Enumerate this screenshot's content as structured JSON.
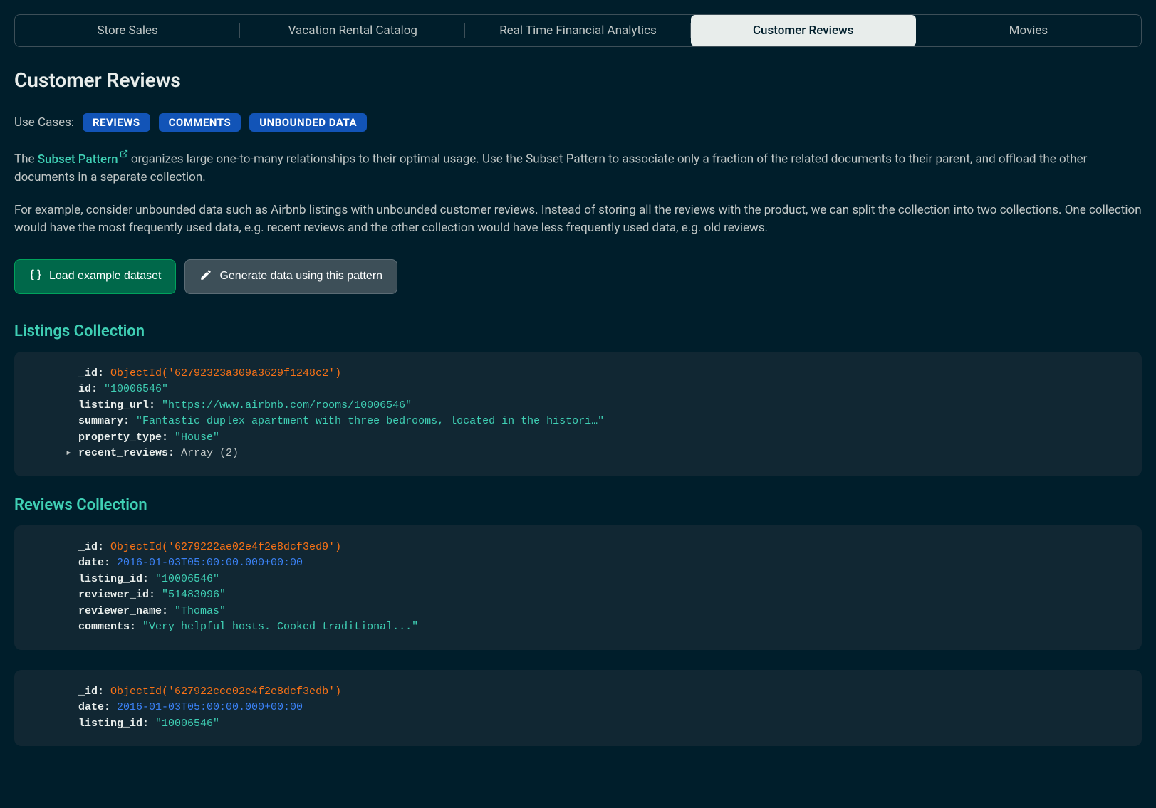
{
  "tabs": [
    {
      "label": "Store Sales",
      "active": false
    },
    {
      "label": "Vacation Rental Catalog",
      "active": false
    },
    {
      "label": "Real Time Financial Analytics",
      "active": false
    },
    {
      "label": "Customer Reviews",
      "active": true
    },
    {
      "label": "Movies",
      "active": false
    }
  ],
  "page_title": "Customer Reviews",
  "use_cases": {
    "label": "Use Cases:",
    "pills": [
      "REVIEWS",
      "COMMENTS",
      "UNBOUNDED DATA"
    ]
  },
  "intro": {
    "prefix": "The ",
    "link_text": "Subset Pattern",
    "link_suffix": " organizes large one-to-many relationships to their optimal usage. Use the Subset Pattern to associate only a fraction of the related documents to their parent, and offload the other documents in a separate collection."
  },
  "para2": "For example, consider unbounded data such as Airbnb listings with unbounded customer reviews. Instead of storing all the reviews with the product, we can split the collection into two collections. One collection would have the most frequently used data, e.g. recent reviews and the other collection would have less frequently used data, e.g. old reviews.",
  "buttons": {
    "load_example": "Load example dataset",
    "generate": "Generate data using this pattern"
  },
  "sections": {
    "listings": {
      "heading": "Listings Collection",
      "doc": {
        "_id": "ObjectId('62792323a309a3629f1248c2')",
        "id": "\"10006546\"",
        "listing_url": "\"https://www.airbnb.com/rooms/10006546\"",
        "summary": "\"Fantastic duplex apartment with three bedrooms, located in the histori…\"",
        "property_type": "\"House\"",
        "recent_reviews": "Array (2)"
      }
    },
    "reviews": {
      "heading": "Reviews Collection",
      "docs": [
        {
          "_id": "ObjectId('6279222ae02e4f2e8dcf3ed9')",
          "date": "2016-01-03T05:00:00.000+00:00",
          "listing_id": "\"10006546\"",
          "reviewer_id": "\"51483096\"",
          "reviewer_name": "\"Thomas\"",
          "comments": "\"Very helpful hosts. Cooked traditional...\""
        },
        {
          "_id": "ObjectId('627922cce02e4f2e8dcf3edb')",
          "date": "2016-01-03T05:00:00.000+00:00",
          "listing_id": "\"10006546\""
        }
      ]
    }
  }
}
